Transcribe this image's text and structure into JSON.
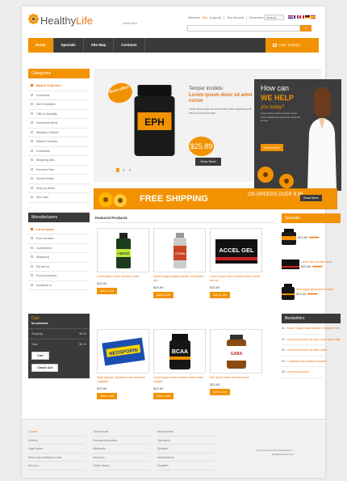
{
  "header": {
    "logo_part1": "Healthy",
    "logo_part2": "Life",
    "tagline": "online store",
    "welcome": "Welcome",
    "welcome_user": "Alim",
    "logout": "(Log out)",
    "your_account": "Your Account",
    "currency_label": "Currencies:",
    "currency_value": "US Dollar",
    "search_placeholder": ""
  },
  "nav": {
    "items": [
      "Home",
      "Specials",
      "Site Map",
      "Contacts"
    ],
    "cart_label": "Cart",
    "cart_status": "(empty)"
  },
  "categories": {
    "title": "Categories",
    "items": [
      "Baby & Child Care",
      "Cosmetics",
      "Diet & Nutrition",
      "Gifts & Specialty",
      "Household Items",
      "Medicine Cabinet",
      "Natural Products",
      "Containers",
      "Shopping Aids",
      "Personal Care",
      "Sexual Health",
      "Shop by Brand",
      "Skin Care"
    ]
  },
  "manufacturers": {
    "title": "Manufacturers",
    "items": [
      "Lorem ipsum",
      "Dolor sit amet",
      "Consectetur",
      "Adipiscing",
      "Elit sed do",
      "Eiusmod tempor",
      "Incididunt ut"
    ]
  },
  "cart": {
    "title": "Cart",
    "empty": "No products",
    "shipping_label": "Shipping",
    "shipping_value": "$0.00",
    "total_label": "Total",
    "total_value": "$0.00",
    "cart_btn": "Cart",
    "checkout_btn": "Check Out"
  },
  "slider": {
    "badge": "Best offer!",
    "product_label": "EPH",
    "line1": "Tempor incididu",
    "line2": "Lorem ipsum dolor sit amet conse",
    "desc": "Lorem ipsum dolor sit amet conse ctetur adipisicing elit, sed do eiusmod tempor",
    "price": "$25.89",
    "shop_now": "Shop Now!",
    "pages": [
      "1",
      "2",
      "3"
    ]
  },
  "help_banner": {
    "line1": "How can",
    "line2": "WE HELP",
    "line3": "you today?",
    "text": "Lorem ipsum dolor sit amet conse ctetur adipisicing elit sed do eiusmod tempor",
    "read_more": "Read More"
  },
  "shipping": {
    "headline": "FREE SHIPPING",
    "sub": "ON ORDERS OVER $ 99",
    "read_more": "Read More"
  },
  "featured": {
    "title": "Featured Products",
    "products": [
      {
        "name": "Lorem ipsum dolor sit amet conse",
        "price": "$25.89",
        "btn": "Add to cart",
        "label": "AMINO"
      },
      {
        "name": "Dolore magna aliqua pariatur. Excepteur sint",
        "price": "$25.89",
        "btn": "Add to cart",
        "label": "VITAMIN"
      },
      {
        "name": "Lorem ipsum dolor sit amet lorem conse etur sit",
        "price": "$25.89",
        "btn": "Add to cart",
        "label": "ACCEL GEL"
      },
      {
        "name": "Nulla pariatur. Excepteur sint occaecat cupidatat",
        "price": "$25.89",
        "btn": "Add to cart",
        "label": "NEOSPORIN"
      },
      {
        "name": "Lorem ipsum dolor sit amet conse ctetur adipisic",
        "price": "$25.89",
        "btn": "Add to cart",
        "label": "BCAA"
      },
      {
        "name": "Sed dolum dolor sit amet conse",
        "price": "$25.89",
        "btn": "Add to cart",
        "label": "GABA"
      }
    ]
  },
  "specials": {
    "title": "Specials",
    "items": [
      {
        "name": "",
        "price": "$25.89",
        "old": "$45.89"
      },
      {
        "name": "Lorem dolor sit amet conse",
        "price": "$25.89",
        "old": "$45.89"
      },
      {
        "name": "Sed magna aliqua dolor sit amet",
        "price": "$25.89",
        "old": "$45.89"
      }
    ]
  },
  "bestsellers": {
    "title": "Bestsellers",
    "items": [
      {
        "n": "01.",
        "t": "Dolore magna aliqua pariatur. Excepteur sint"
      },
      {
        "n": "02.",
        "t": "Lorem ipsum dolor sit amet conse ctetur adip"
      },
      {
        "n": "03.",
        "t": "Lorem ipsum dolor sit amet conse"
      },
      {
        "n": "04.",
        "t": "Cupidatat nulla pariatur excepteur"
      },
      {
        "n": "05.",
        "t": "Lorem ipsum dolor"
      }
    ]
  },
  "footer": {
    "col1": [
      "Contact",
      "Delivery",
      "Legal Notice",
      "Terms and conditions of use",
      "About us"
    ],
    "col2": [
      "Your Account",
      "Personal information",
      "Addresses",
      "Discounts",
      "Orders history"
    ],
    "col3": [
      "New products",
      "Top sellers",
      "Specials",
      "Manufacturers",
      "Suppliers"
    ],
    "copyright": "© 2012 Powered by PrestaShop™",
    "rights": "All Rights Reserved"
  },
  "colors": {
    "accent": "#f39200",
    "dark": "#3a3a3a"
  }
}
